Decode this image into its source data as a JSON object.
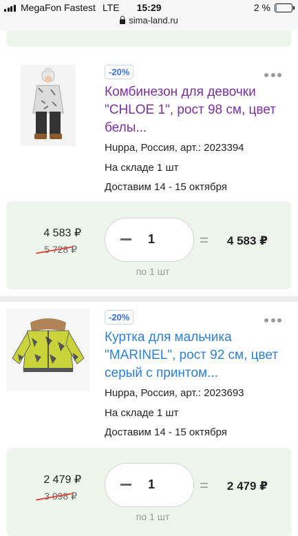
{
  "status_bar": {
    "carrier": "MegaFon Fastest",
    "network": "LTE",
    "time": "15:29",
    "battery": "2 %",
    "battery_level": 0.04,
    "battery_color": "#e53935"
  },
  "url_bar": {
    "url": "sima-land.ru",
    "lock_icon": "lock-icon"
  },
  "products": [
    {
      "discount": "-20%",
      "title": "Комбинезон для девочки \"CHLOE 1\", рост 98 см, цвет белы...",
      "title_state": "visited",
      "brand_line": "Huppa, Россия, арт.: 2023394",
      "stock": "На складе 1 шт",
      "delivery": "Доставим 14 - 15 октября",
      "price": "4 583 ₽",
      "old_price": "5 728 ₽",
      "quantity": "1",
      "equals": "=",
      "total": "4 583 ₽",
      "per_unit": "по 1 шт"
    },
    {
      "discount": "-20%",
      "title": "Куртка для мальчика \"MARINEL\", рост 92 см, цвет серый с принтом...",
      "title_state": "link",
      "brand_line": "Huppa, Россия, арт.: 2023693",
      "stock": "На складе 1 шт",
      "delivery": "Доставим 14 - 15 октября",
      "price": "2 479 ₽",
      "old_price": "3 098 ₽",
      "quantity": "1",
      "equals": "=",
      "total": "2 479 ₽",
      "per_unit": "по 1 шт"
    }
  ],
  "colors": {
    "visited_title": "#7a2fa0",
    "link_title": "#2f7fd3",
    "badge": "#3a6fd6",
    "price_area_bg": "#eef6ec",
    "strike": "#e0453a"
  }
}
